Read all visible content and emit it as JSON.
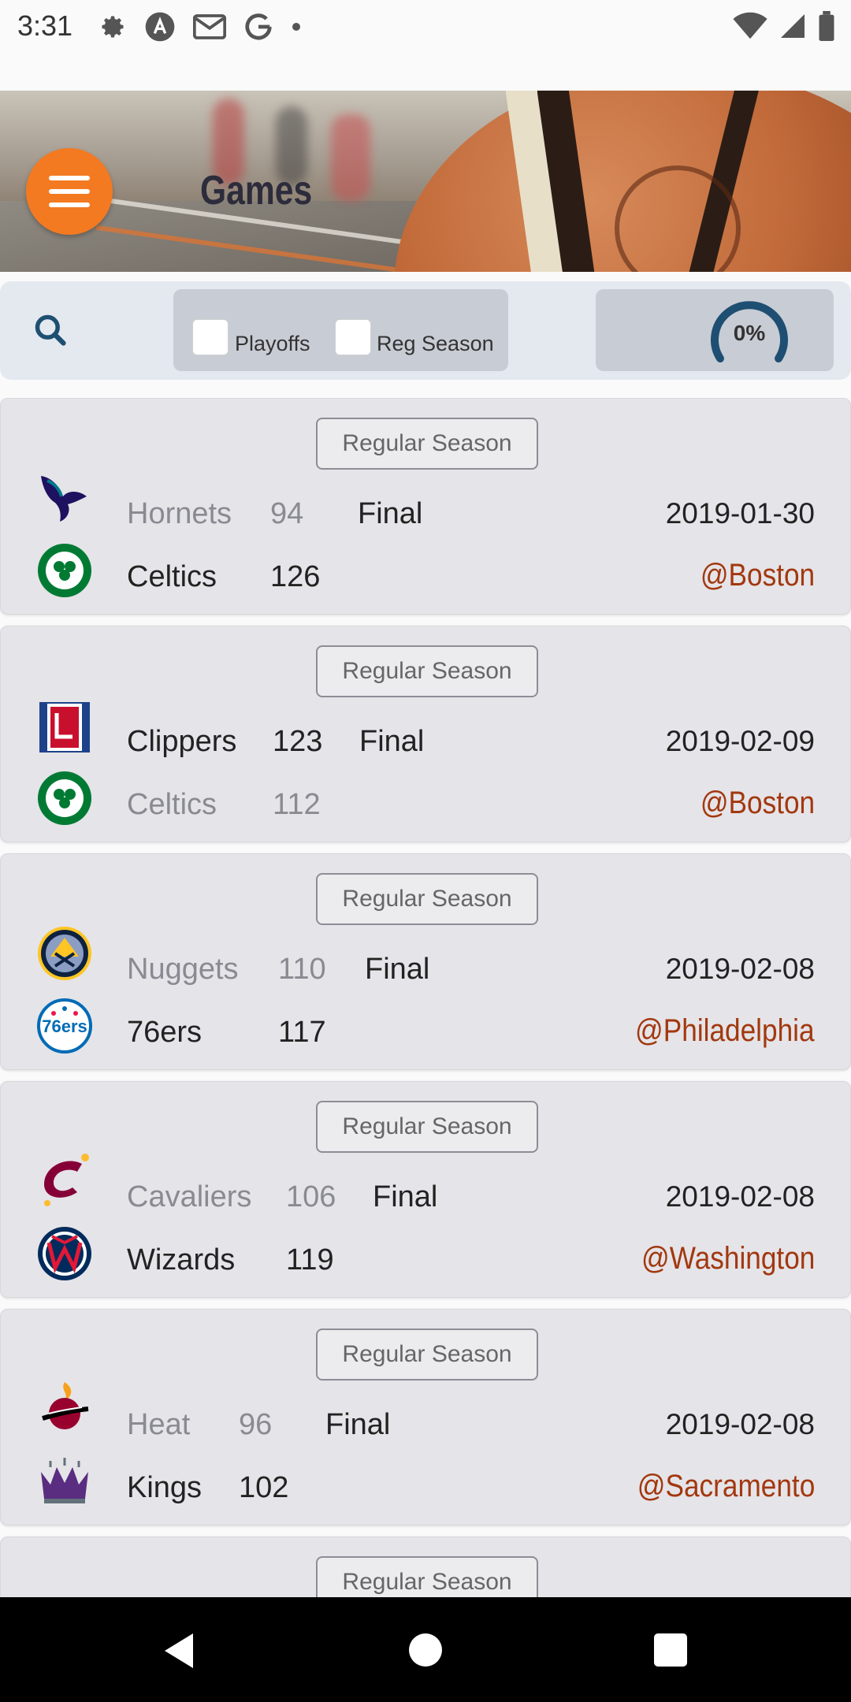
{
  "status_bar": {
    "time": "3:31"
  },
  "header": {
    "title": "Games"
  },
  "filters": {
    "playoffs_label": "Playoffs",
    "regular_season_label": "Reg Season",
    "progress_text": "0%",
    "progress_value": 0
  },
  "games": [
    {
      "badge": "Regular Season",
      "away": {
        "name": "Hornets",
        "score": "94",
        "logo": "hornets-logo"
      },
      "home": {
        "name": "Celtics",
        "score": "126",
        "logo": "celtics-logo"
      },
      "status": "Final",
      "date": "2019-01-30",
      "venue": "@Boston"
    },
    {
      "badge": "Regular Season",
      "away": {
        "name": "Clippers",
        "score": "123",
        "logo": "clippers-logo"
      },
      "home": {
        "name": "Celtics",
        "score": "112",
        "logo": "celtics-logo"
      },
      "status": "Final",
      "date": "2019-02-09",
      "venue": "@Boston"
    },
    {
      "badge": "Regular Season",
      "away": {
        "name": "Nuggets",
        "score": "110",
        "logo": "nuggets-logo"
      },
      "home": {
        "name": "76ers",
        "score": "117",
        "logo": "76ers-logo"
      },
      "status": "Final",
      "date": "2019-02-08",
      "venue": "@Philadelphia"
    },
    {
      "badge": "Regular Season",
      "away": {
        "name": "Cavaliers",
        "score": "106",
        "logo": "cavaliers-logo"
      },
      "home": {
        "name": "Wizards",
        "score": "119",
        "logo": "wizards-logo"
      },
      "status": "Final",
      "date": "2019-02-08",
      "venue": "@Washington"
    },
    {
      "badge": "Regular Season",
      "away": {
        "name": "Heat",
        "score": "96",
        "logo": "heat-logo"
      },
      "home": {
        "name": "Kings",
        "score": "102",
        "logo": "kings-logo"
      },
      "status": "Final",
      "date": "2019-02-08",
      "venue": "@Sacramento"
    },
    {
      "badge": "Regular Season"
    }
  ],
  "colors": {
    "accent_orange": "#f37a21",
    "venue_text": "#a2380f",
    "card_bg": "#e5e4e8"
  }
}
